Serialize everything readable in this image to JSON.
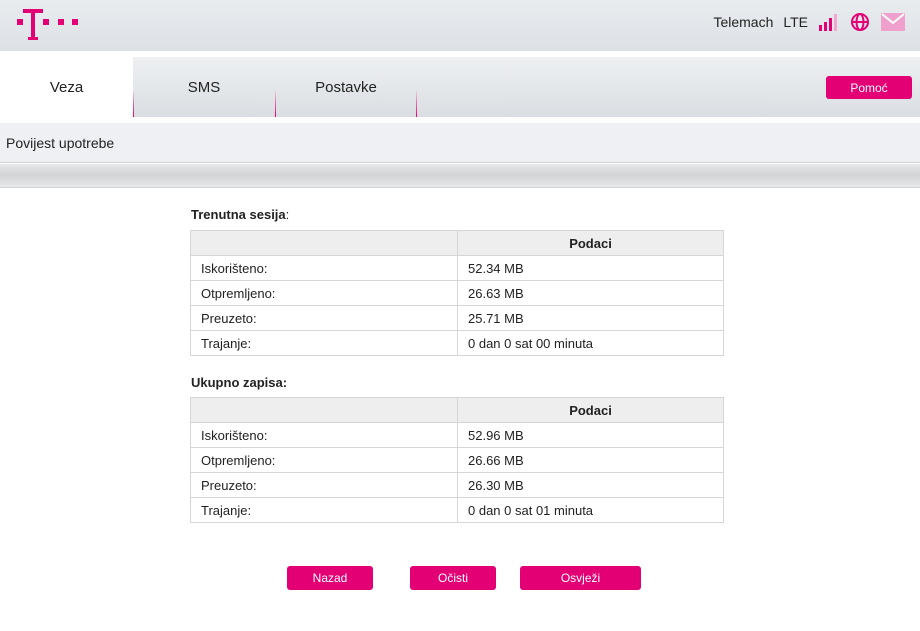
{
  "header": {
    "operator": "Telemach",
    "network": "LTE",
    "icons": [
      "signal-icon",
      "globe-icon",
      "mail-icon"
    ]
  },
  "tabs": [
    {
      "label": "Veza",
      "active": true
    },
    {
      "label": "SMS"
    },
    {
      "label": "Postavke"
    }
  ],
  "help_label": "Pomoć",
  "page_title": "Povijest upotrebe",
  "current": {
    "title": "Trenutna sesija",
    "colon": ":",
    "header": "Podaci",
    "rows": [
      {
        "label": "Iskorišteno:",
        "value": "52.34 MB"
      },
      {
        "label": "Otpremljeno:",
        "value": "26.63 MB"
      },
      {
        "label": "Preuzeto:",
        "value": "25.71 MB"
      },
      {
        "label": "Trajanje:",
        "value": "0 dan 0 sat 00 minuta"
      }
    ]
  },
  "total": {
    "title": "Ukupno zapisa:",
    "header": "Podaci",
    "rows": [
      {
        "label": "Iskorišteno:",
        "value": "52.96 MB"
      },
      {
        "label": "Otpremljeno:",
        "value": "26.66 MB"
      },
      {
        "label": "Preuzeto:",
        "value": "26.30 MB"
      },
      {
        "label": "Trajanje:",
        "value": "0 dan 0 sat 01 minuta"
      }
    ]
  },
  "buttons": {
    "back": "Nazad",
    "clear": "Očisti",
    "refresh": "Osvježi"
  },
  "colors": {
    "accent": "#e20074"
  }
}
